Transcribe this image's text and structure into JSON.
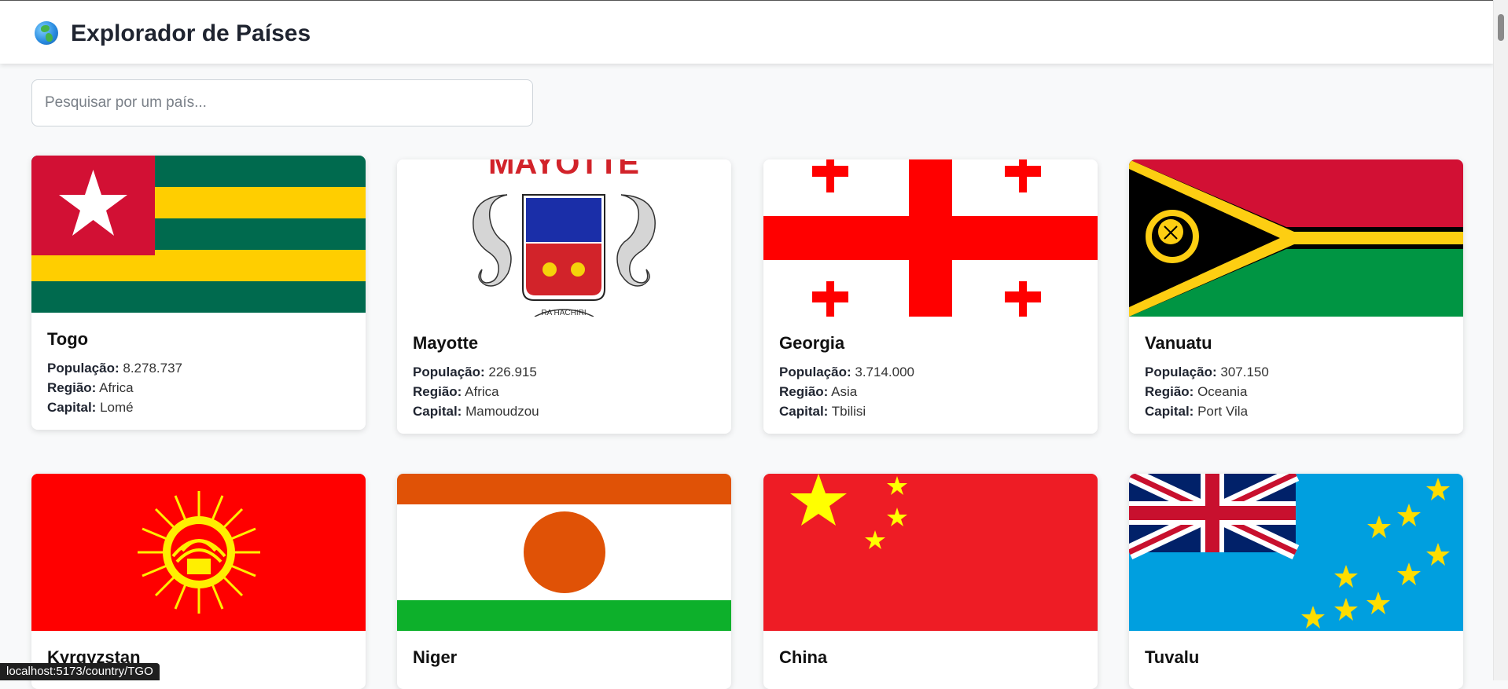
{
  "header": {
    "icon": "globe-icon",
    "title": "Explorador de Países"
  },
  "search": {
    "placeholder": "Pesquisar por um país...",
    "value": ""
  },
  "labels": {
    "population": "População:",
    "region": "Região:",
    "capital": "Capital:"
  },
  "countries": [
    {
      "name": "Togo",
      "population": "8.278.737",
      "region": "Africa",
      "capital": "Lomé"
    },
    {
      "name": "Mayotte",
      "population": "226.915",
      "region": "Africa",
      "capital": "Mamoudzou",
      "flag_text_top": "MAYOTTE",
      "flag_text_motto": "RA HACHIRI"
    },
    {
      "name": "Georgia",
      "population": "3.714.000",
      "region": "Asia",
      "capital": "Tbilisi"
    },
    {
      "name": "Vanuatu",
      "population": "307.150",
      "region": "Oceania",
      "capital": "Port Vila"
    },
    {
      "name": "Kyrgyzstan"
    },
    {
      "name": "Niger"
    },
    {
      "name": "China"
    },
    {
      "name": "Tuvalu"
    }
  ],
  "status_bar": {
    "url": "localhost:5173/country/TGO"
  }
}
